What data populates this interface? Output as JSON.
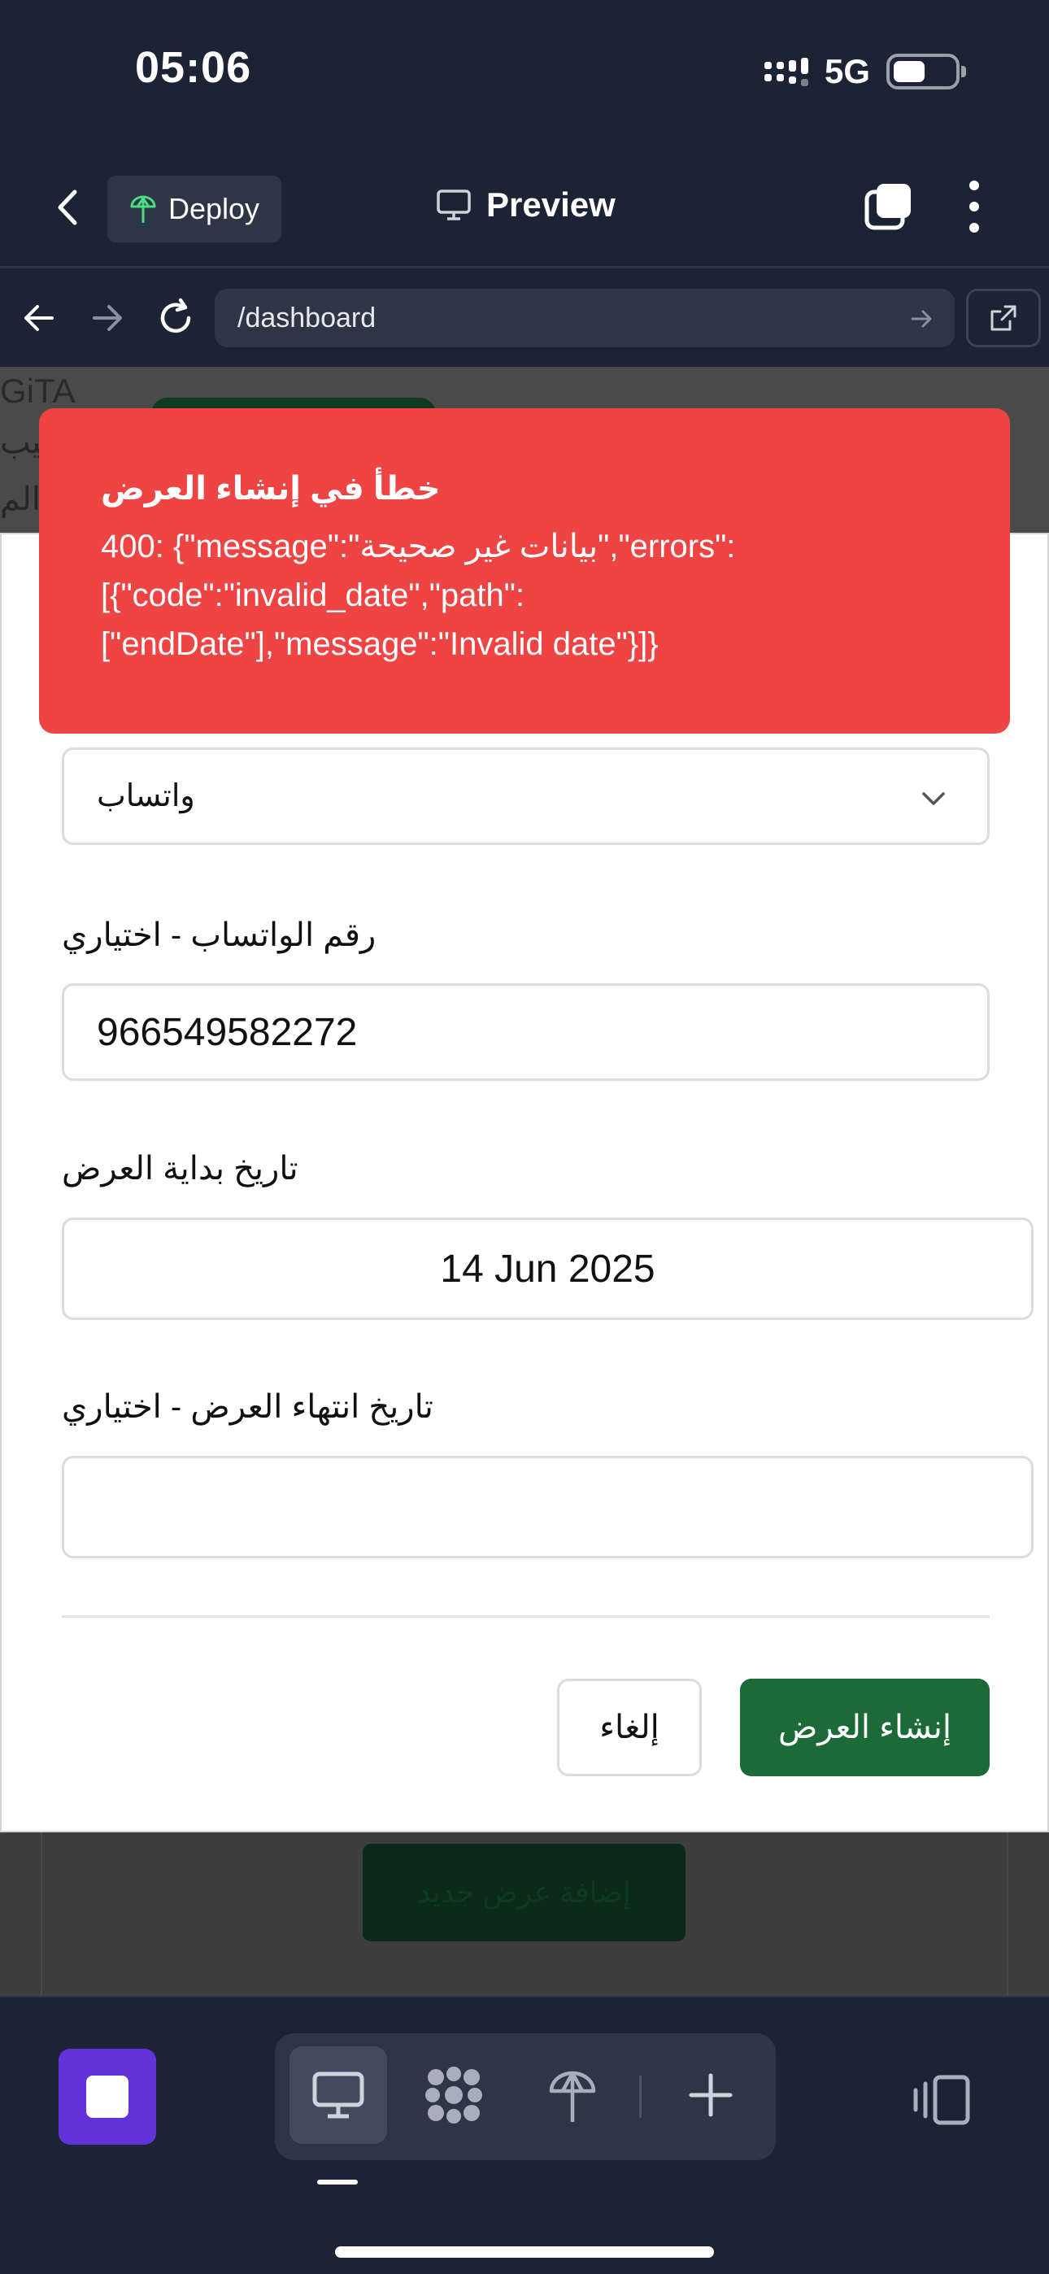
{
  "status_bar": {
    "time": "05:06",
    "network": "5G"
  },
  "top_bar": {
    "deploy_label": "Deploy",
    "preview_label": "Preview"
  },
  "url_bar": {
    "url": "/dashboard"
  },
  "background_page": {
    "brand": "GiTA",
    "text_line1": "هيب",
    "text_line2": "الم",
    "add_offer_label": "إضافة عرض جديد"
  },
  "toast": {
    "title": "خطأ في إنشاء العرض",
    "message": "400: {\"message\":\"بيانات غير صحيحة\",\"errors\":[{\"code\":\"invalid_date\",\"path\":[\"endDate\"],\"message\":\"Invalid date\"}]}",
    "color": "#ef4444"
  },
  "form": {
    "contact_method_value": "واتساب",
    "whatsapp_label": "رقم الواتساب - اختياري",
    "whatsapp_value": "966549582272",
    "start_date_label": "تاريخ بداية العرض",
    "start_date_value": "14 Jun 2025",
    "end_date_label": "تاريخ انتهاء العرض - اختياري",
    "end_date_value": "",
    "cancel_label": "إلغاء",
    "create_label": "إنشاء العرض",
    "accent_color": "#1b6a37"
  },
  "dock": {
    "items": [
      "monitor-icon",
      "grid-icon",
      "deploy-icon",
      "plus-icon"
    ],
    "active": "monitor-icon"
  }
}
